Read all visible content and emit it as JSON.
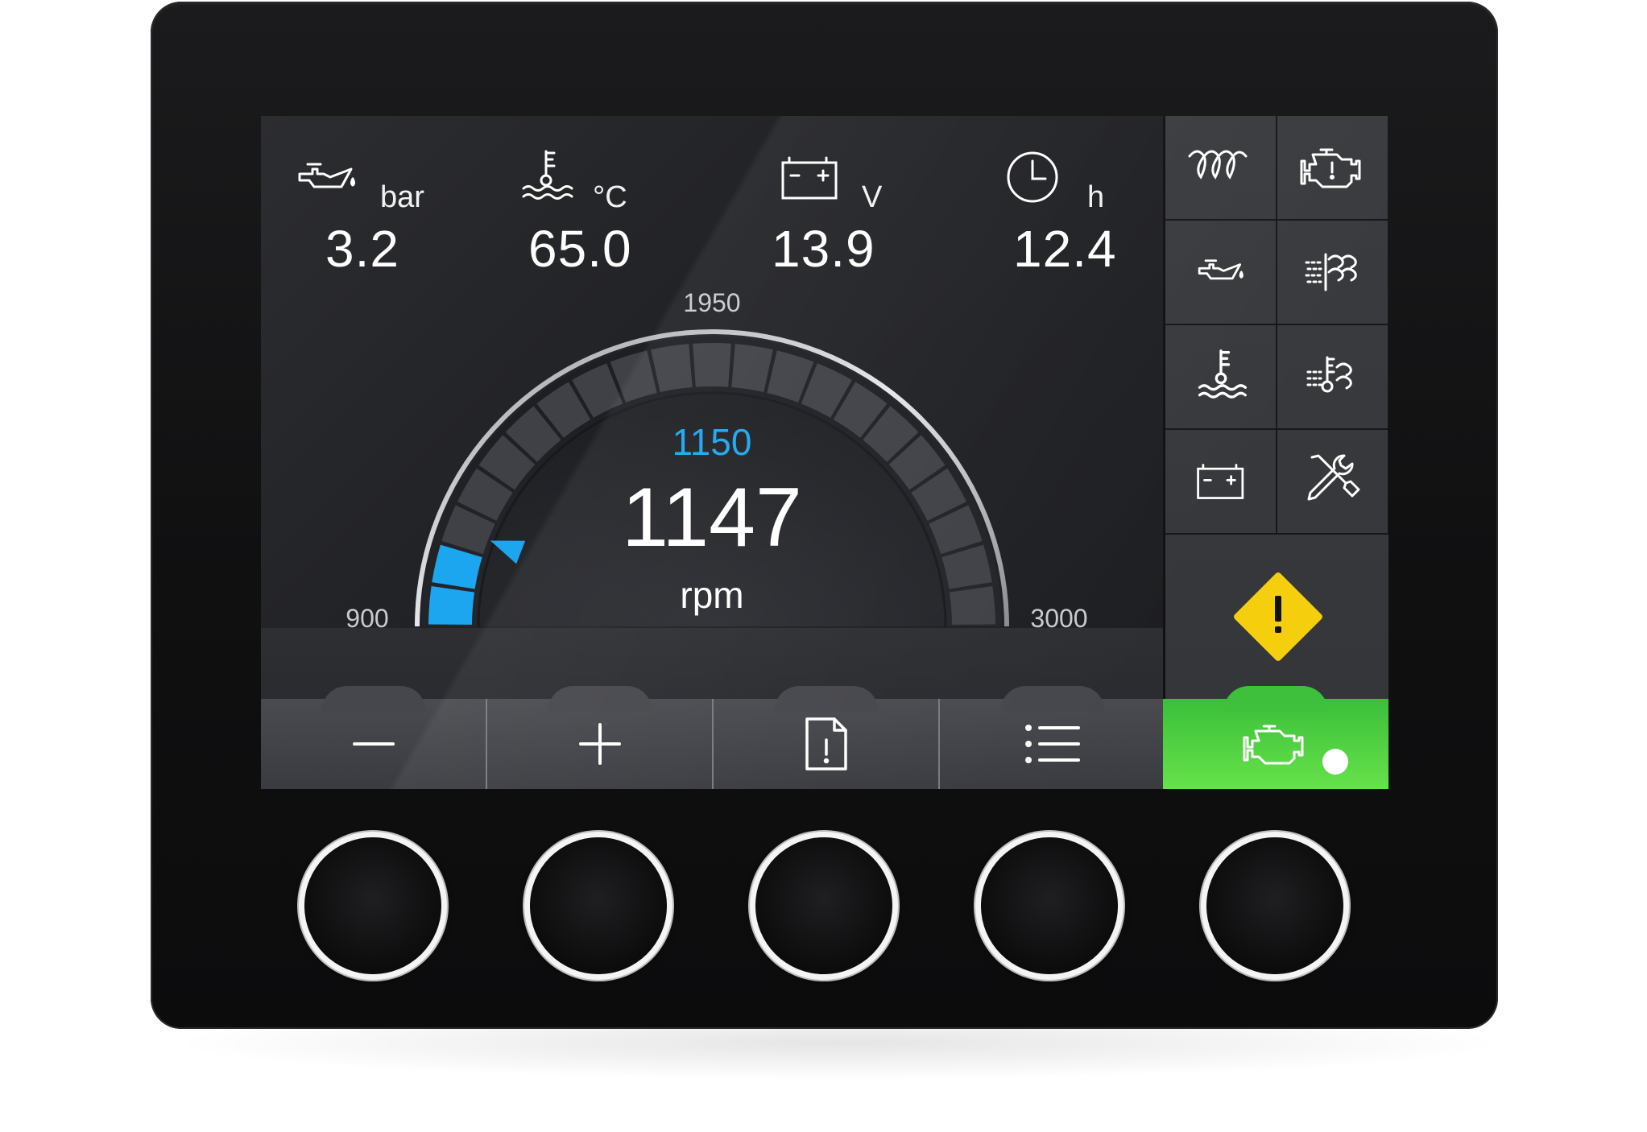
{
  "metrics": [
    {
      "icon": "oil-pressure-icon",
      "unit": "bar",
      "value": "3.2"
    },
    {
      "icon": "coolant-temperature-icon",
      "unit": "°C",
      "value": "65.0"
    },
    {
      "icon": "battery-icon",
      "unit": "V",
      "value": "13.9"
    },
    {
      "icon": "clock-icon",
      "unit": "h",
      "value": "12.4"
    }
  ],
  "gauge": {
    "min_label": "900",
    "max_label": "3000",
    "top_label": "1950",
    "setpoint": "1150",
    "value": "1147",
    "unit": "rpm",
    "min": 900,
    "max": 3000,
    "current": 1147,
    "segments_total": 21,
    "accent_color": "#1da6f0"
  },
  "indicators": [
    "glow-plug-icon",
    "check-engine-icon",
    "oil-pressure-icon",
    "air-filter-icon",
    "coolant-temperature-icon",
    "intake-air-temperature-icon",
    "battery-icon",
    "service-tools-icon"
  ],
  "warning": {
    "icon": "warning-diamond-icon",
    "color": "#f5cf0d"
  },
  "softkeys": [
    {
      "icon": "minus-icon"
    },
    {
      "icon": "plus-icon"
    },
    {
      "icon": "alarm-document-icon"
    },
    {
      "icon": "menu-list-icon"
    },
    {
      "icon": "engine-running-icon",
      "color": "#4cd43f"
    }
  ],
  "hardware_buttons": 5
}
